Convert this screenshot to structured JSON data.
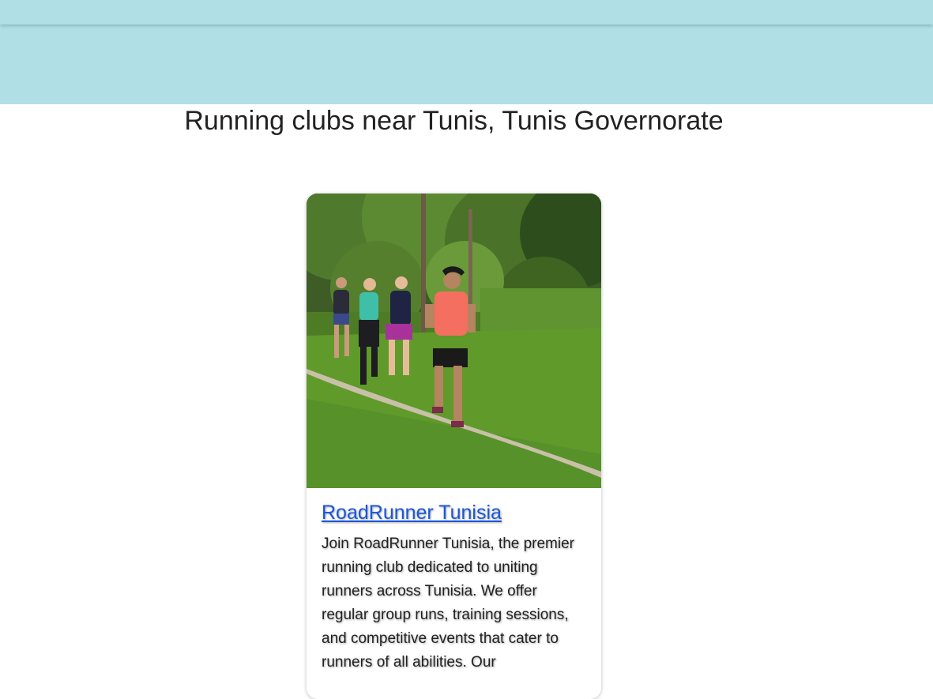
{
  "header": {
    "bar_color": "#b0dfe5"
  },
  "page": {
    "title": "Running clubs near Tunis, Tunis Governorate"
  },
  "club_card": {
    "image_description_icon": "runners-photo",
    "name": "RoadRunner Tunisia",
    "description": "Join RoadRunner Tunisia, the premier running club dedicated to uniting runners across Tunisia. We offer regular group runs, training sessions, and competitive events that cater to runners of all abilities. Our",
    "link_color": "#1a56db"
  }
}
